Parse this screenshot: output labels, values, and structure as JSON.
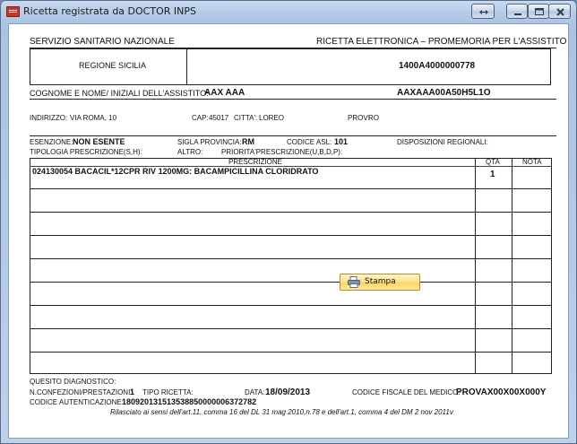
{
  "window": {
    "title": "Ricetta registrata da DOCTOR INPS"
  },
  "header": {
    "left": "SERVIZIO SANITARIO NAZIONALE",
    "right": "RICETTA ELETTRONICA – PROMEMORIA PER L'ASSISTITO",
    "region": "REGIONE SICILIA",
    "code": "1400A4000000778"
  },
  "patient": {
    "name_label": "COGNOME E NOME/ INIZIALI DELL'ASSISTITO:",
    "name_value": "AAX AAA",
    "cf_value": "AAXAAA00A50H5L1O",
    "address_label": "INDIRIZZO:",
    "address_value": "VIA ROMA, 10",
    "cap_label": "CAP:",
    "cap_value": "45017",
    "city_label": "CITTA':",
    "city_value": "LOREO",
    "prov_label": "PROV:",
    "prov_value": "RO"
  },
  "info": {
    "esenzione_label": "ESENZIONE:",
    "esenzione_value": "NON ESENTE",
    "sigla_label": "SIGLA PROVINCIA:",
    "sigla_value": "RM",
    "asl_label": "CODICE ASL:",
    "asl_value": "101",
    "disp_label": "DISPOSIZIONI REGIONALI:",
    "tipologia_label": "TIPOLOGIA PRESCRIZIONE(S,H):",
    "altro_label": "ALTRO:",
    "priorita_label": "PRIORITA'PRESCRIZIONE(U,B,D,P):"
  },
  "table": {
    "col_prescrizione": "PRESCRIZIONE",
    "col_qta": "QTA",
    "col_nota": "NOTA",
    "rows": [
      {
        "prescrizione": "024130054 BACACIL*12CPR RIV 1200MG: BACAMPICILLINA CLORIDRATO",
        "qta": "1",
        "nota": ""
      }
    ]
  },
  "footer": {
    "quesito_label": "QUESITO DIAGNOSTICO:",
    "confezioni_label": "N.CONFEZIONI/PRESTAZIONI:",
    "confezioni_value": "1",
    "tipo_label": "TIPO RICETTA:",
    "data_label": "DATA:",
    "data_value": "18/09/2013",
    "cf_medico_label": "CODICE FISCALE DEL MEDICO:",
    "cf_medico_value": "PROVAX00X00X000Y",
    "autenticazione_label": "CODICE AUTENTICAZIONE:",
    "autenticazione_value": "180920131513538850000006372782",
    "legal": "Rilasciato ai sensi dell'art.11, comma 16 del DL 31 mag 2010,n.78 e dell'art.1, comma 4 del DM 2 nov 2011v"
  },
  "stampa_button": {
    "label": "Stampa"
  }
}
